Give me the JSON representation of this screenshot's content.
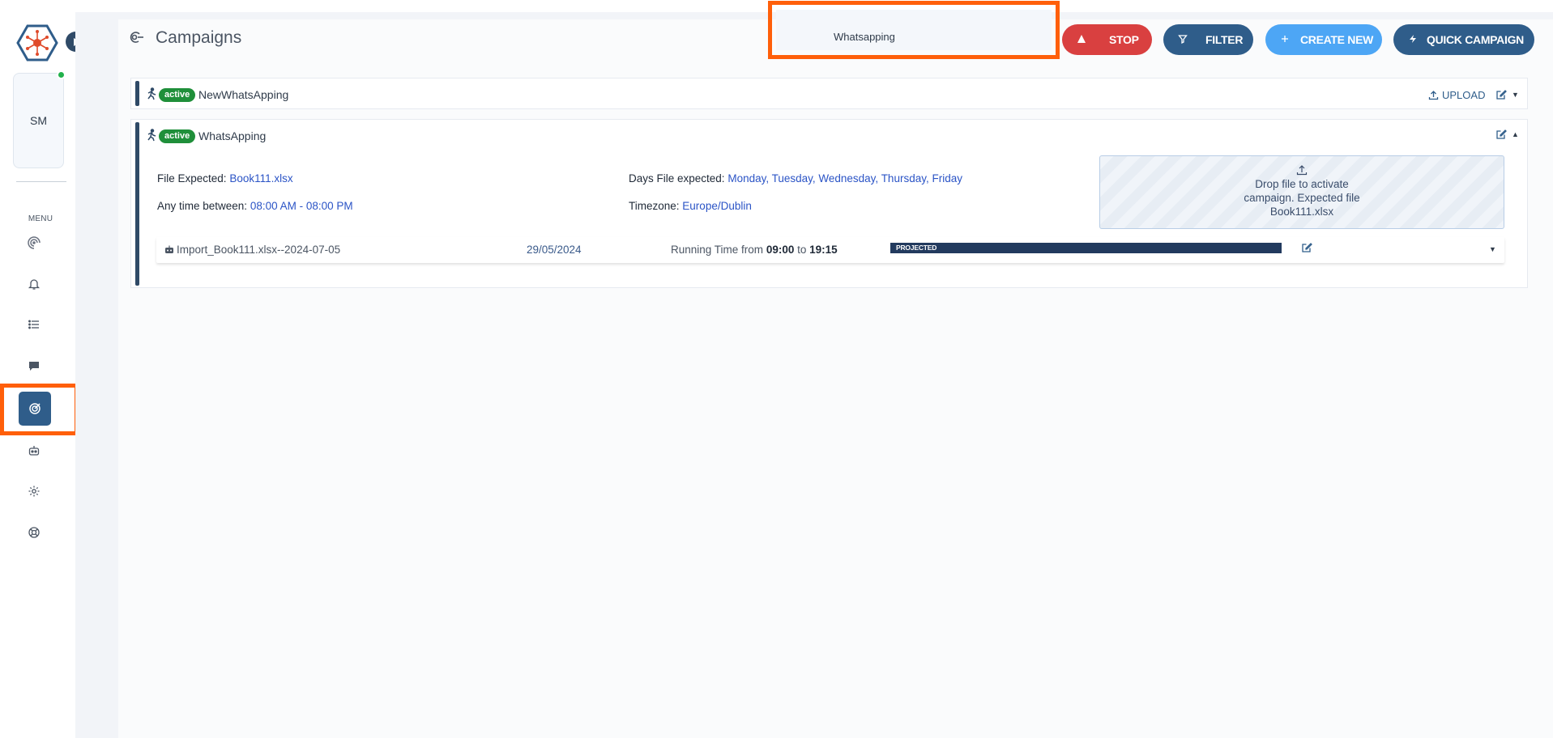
{
  "sidebar": {
    "user_initials": "SM",
    "menu_label": "MENU",
    "items": [
      {
        "name": "campaigns-radar",
        "icon": "radar-icon"
      },
      {
        "name": "notifications",
        "icon": "bell-icon"
      },
      {
        "name": "lists",
        "icon": "list-icon"
      },
      {
        "name": "messages",
        "icon": "chat-icon"
      },
      {
        "name": "campaigns",
        "icon": "target-icon",
        "active": true
      },
      {
        "name": "bots",
        "icon": "robot-icon"
      },
      {
        "name": "settings",
        "icon": "gear-icon"
      },
      {
        "name": "help",
        "icon": "lifebuoy-icon"
      }
    ]
  },
  "header": {
    "title": "Campaigns",
    "search": {
      "value": "Whatsapping",
      "placeholder": ""
    },
    "buttons": {
      "stop": "STOP",
      "filter": "FILTER",
      "create_new": "CREATE NEW",
      "quick_campaign": "QUICK CAMPAIGN"
    }
  },
  "campaigns": [
    {
      "status": "active",
      "name": "NewWhatsApping",
      "upload_label": "UPLOAD"
    },
    {
      "status": "active",
      "name": "WhatsApping",
      "file_expected_label": "File Expected:",
      "file_expected": "Book111.xlsx",
      "days_label": "Days File expected:",
      "days": "Monday, Tuesday, Wednesday, Thursday, Friday",
      "anytime_label": "Any time between:",
      "anytime": "08:00 AM - 08:00 PM",
      "timezone_label": "Timezone:",
      "timezone": "Europe/Dublin",
      "dropzone": {
        "line1": "Drop file to activate",
        "line2": "campaign. Expected file",
        "line3": "Book111.xlsx"
      },
      "import": {
        "name": "Import_Book111.xlsx--2024-07-05",
        "date": "29/05/2024",
        "running_prefix": "Running Time from",
        "from": "09:00",
        "to_word": "to",
        "to": "19:15",
        "progress_label": "PROJECTED",
        "progress": 1.0
      }
    }
  ],
  "colors": {
    "primary": "#2f5d8a",
    "stop": "#d94040",
    "create": "#4da6f5",
    "active_badge": "#1f8f3a",
    "highlight": "#ff5f0a",
    "progress": "#223a5e"
  }
}
